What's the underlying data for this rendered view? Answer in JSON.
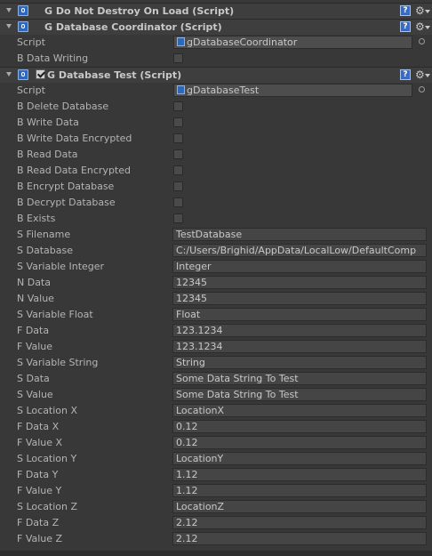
{
  "components": [
    {
      "title": "G Do Not Destroy On Load (Script)",
      "has_enable_check": false,
      "icon": "csharp-script-icon"
    },
    {
      "title": "G Database Coordinator (Script)",
      "has_enable_check": false,
      "icon": "csharp-script-icon",
      "script_label": "Script",
      "script_value": "gDatabaseCoordinator",
      "fields": [
        {
          "label": "B Data Writing",
          "type": "checkbox",
          "checked": false
        }
      ]
    },
    {
      "title": "G Database Test (Script)",
      "has_enable_check": true,
      "enabled": true,
      "icon": "csharp-script-icon",
      "script_label": "Script",
      "script_value": "gDatabaseTest",
      "fields": [
        {
          "label": "B Delete Database",
          "type": "checkbox",
          "checked": false
        },
        {
          "label": "B Write Data",
          "type": "checkbox",
          "checked": false
        },
        {
          "label": "B Write Data Encrypted",
          "type": "checkbox",
          "checked": false
        },
        {
          "label": "B Read Data",
          "type": "checkbox",
          "checked": false
        },
        {
          "label": "B Read Data Encrypted",
          "type": "checkbox",
          "checked": false
        },
        {
          "label": "B Encrypt Database",
          "type": "checkbox",
          "checked": false
        },
        {
          "label": "B Decrypt Database",
          "type": "checkbox",
          "checked": false
        },
        {
          "label": "B Exists",
          "type": "checkbox",
          "checked": false
        },
        {
          "label": "S Filename",
          "type": "text",
          "value": "TestDatabase"
        },
        {
          "label": "S Database",
          "type": "text",
          "value": "C:/Users/Brighid/AppData/LocalLow/DefaultComp"
        },
        {
          "label": "S Variable Integer",
          "type": "text",
          "value": "Integer"
        },
        {
          "label": "N Data",
          "type": "text",
          "value": "12345"
        },
        {
          "label": "N Value",
          "type": "text",
          "value": "12345"
        },
        {
          "label": "S Variable Float",
          "type": "text",
          "value": "Float"
        },
        {
          "label": "F Data",
          "type": "text",
          "value": "123.1234"
        },
        {
          "label": "F Value",
          "type": "text",
          "value": "123.1234"
        },
        {
          "label": "S Variable String",
          "type": "text",
          "value": "String"
        },
        {
          "label": "S Data",
          "type": "text",
          "value": "Some Data String To Test"
        },
        {
          "label": "S Value",
          "type": "text",
          "value": "Some Data String To Test"
        },
        {
          "label": "S Location X",
          "type": "text",
          "value": "LocationX"
        },
        {
          "label": "F Data X",
          "type": "text",
          "value": "0.12"
        },
        {
          "label": "F Value X",
          "type": "text",
          "value": "0.12"
        },
        {
          "label": "S Location Y",
          "type": "text",
          "value": "LocationY"
        },
        {
          "label": "F Data Y",
          "type": "text",
          "value": "1.12"
        },
        {
          "label": "F Value Y",
          "type": "text",
          "value": "1.12"
        },
        {
          "label": "S Location Z",
          "type": "text",
          "value": "LocationZ"
        },
        {
          "label": "F Data Z",
          "type": "text",
          "value": "2.12"
        },
        {
          "label": "F Value Z",
          "type": "text",
          "value": "2.12"
        }
      ]
    }
  ],
  "header_icons": {
    "help": "help-icon",
    "settings": "gear-icon",
    "help_glyph": "?"
  },
  "colors": {
    "background": "#383838",
    "header": "#3e3e3e",
    "field": "#454545",
    "script_icon": "#2f68b8"
  }
}
